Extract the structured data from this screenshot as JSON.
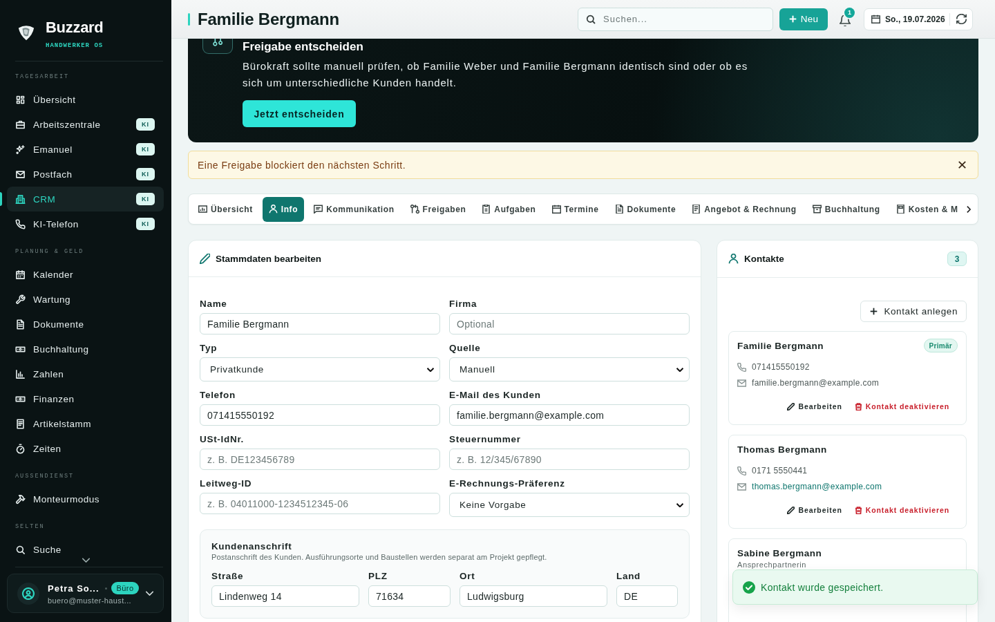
{
  "sidebar": {
    "brand": {
      "name": "Buzzard",
      "tagline": "HANDWERKER OS"
    },
    "sections": [
      {
        "label": "TAGESARBEIT",
        "items": [
          {
            "label": "Übersicht",
            "selected": false
          },
          {
            "label": "Arbeitszentrale",
            "badge": "KI",
            "selected": false
          },
          {
            "label": "Emanuel",
            "badge": "KI",
            "selected": false
          },
          {
            "label": "Postfach",
            "badge": "KI",
            "selected": false
          },
          {
            "label": "CRM",
            "badge": "KI",
            "selected": true
          },
          {
            "label": "KI-Telefon",
            "badge": "KI",
            "selected": false
          }
        ]
      },
      {
        "label": "PLANUNG & GELD",
        "items": [
          {
            "label": "Kalender",
            "selected": false
          },
          {
            "label": "Wartung",
            "selected": false
          },
          {
            "label": "Dokumente",
            "selected": false
          },
          {
            "label": "Buchhaltung",
            "selected": false
          },
          {
            "label": "Zahlen",
            "selected": false
          },
          {
            "label": "Finanzen",
            "selected": false
          },
          {
            "label": "Artikelstamm",
            "selected": false
          },
          {
            "label": "Zeiten",
            "selected": false
          }
        ]
      },
      {
        "label": "AUSSENDIENST",
        "items": [
          {
            "label": "Monteurmodus",
            "selected": false
          }
        ]
      },
      {
        "label": "SELTEN",
        "items": [
          {
            "label": "Suche",
            "selected": false
          }
        ]
      }
    ],
    "user": {
      "name": "Petra So...",
      "role": "Büro",
      "email": "buero@muster-haust..."
    }
  },
  "header": {
    "title": "Familie Bergmann",
    "search": {
      "placeholder": "Suchen..."
    },
    "new_button": "Neu",
    "notification_count": "1",
    "date": "So., 19.07.2026"
  },
  "banner": {
    "title": "Freigabe entscheiden",
    "text": "Bürokraft sollte manuell prüfen, ob Familie Weber und Familie Bergmann identisch sind oder ob es sich um unterschiedliche Kunden handelt.",
    "button": "Jetzt entscheiden"
  },
  "alert": {
    "text": "Eine Freigabe blockiert den nächsten Schritt."
  },
  "tabs": [
    {
      "label": "Übersicht",
      "selected": false
    },
    {
      "label": "Info",
      "selected": true
    },
    {
      "label": "Kommunikation",
      "selected": false
    },
    {
      "label": "Freigaben",
      "selected": false
    },
    {
      "label": "Aufgaben",
      "selected": false
    },
    {
      "label": "Termine",
      "selected": false
    },
    {
      "label": "Dokumente",
      "selected": false
    },
    {
      "label": "Angebot & Rechnung",
      "selected": false
    },
    {
      "label": "Buchhaltung",
      "selected": false
    },
    {
      "label": "Kosten & M",
      "selected": false
    }
  ],
  "form": {
    "title": "Stammdaten bearbeiten",
    "fields": [
      {
        "label": "Name",
        "kind": "input",
        "value": "Familie Bergmann"
      },
      {
        "label": "Firma",
        "kind": "input",
        "placeholder": "Optional"
      },
      {
        "label": "Typ",
        "kind": "select",
        "value": "Privatkunde"
      },
      {
        "label": "Quelle",
        "kind": "select",
        "value": "Manuell"
      },
      {
        "label": "Telefon",
        "kind": "input",
        "value": "071415550192"
      },
      {
        "label": "E-Mail des Kunden",
        "kind": "input",
        "value": "familie.bergmann@example.com"
      },
      {
        "label": "USt-IdNr.",
        "kind": "input",
        "placeholder": "z. B. DE123456789"
      },
      {
        "label": "Steuernummer",
        "kind": "input",
        "placeholder": "z. B. 12/345/67890"
      },
      {
        "label": "Leitweg-ID",
        "kind": "input",
        "placeholder": "z. B. 04011000-1234512345-06"
      },
      {
        "label": "E-Rechnungs-Präferenz",
        "kind": "select",
        "value": "Keine Vorgabe"
      }
    ],
    "address": {
      "title": "Kundenanschrift",
      "hint": "Postanschrift des Kunden. Ausführungsorte und Baustellen werden separat am Projekt gepflegt.",
      "fields": [
        {
          "label": "Straße",
          "value": "Lindenweg 14"
        },
        {
          "label": "PLZ",
          "value": "71634"
        },
        {
          "label": "Ort",
          "value": "Ludwigsburg"
        },
        {
          "label": "Land",
          "value": "DE"
        }
      ]
    }
  },
  "contacts": {
    "title": "Kontakte",
    "count": "3",
    "add_button": "Kontakt anlegen",
    "items": [
      {
        "name": "Familie Bergmann",
        "badge": "Primär",
        "phone": "071415550192",
        "email": "familie.bergmann@example.com",
        "email_link": false,
        "actions": [
          {
            "kind": "edit",
            "label": "Bearbeiten"
          },
          {
            "kind": "deactivate",
            "label": "Kontakt deaktivieren"
          }
        ]
      },
      {
        "name": "Thomas Bergmann",
        "phone": "0171 5550441",
        "email": "thomas.bergmann@example.com",
        "email_link": true,
        "actions": [
          {
            "kind": "edit",
            "label": "Bearbeiten"
          },
          {
            "kind": "deactivate",
            "label": "Kontakt deaktivieren"
          }
        ]
      },
      {
        "name": "Sabine Bergmann",
        "role": "Ansprechpartnerin"
      }
    ]
  },
  "toast": {
    "text": "Kontakt wurde gespeichert."
  }
}
